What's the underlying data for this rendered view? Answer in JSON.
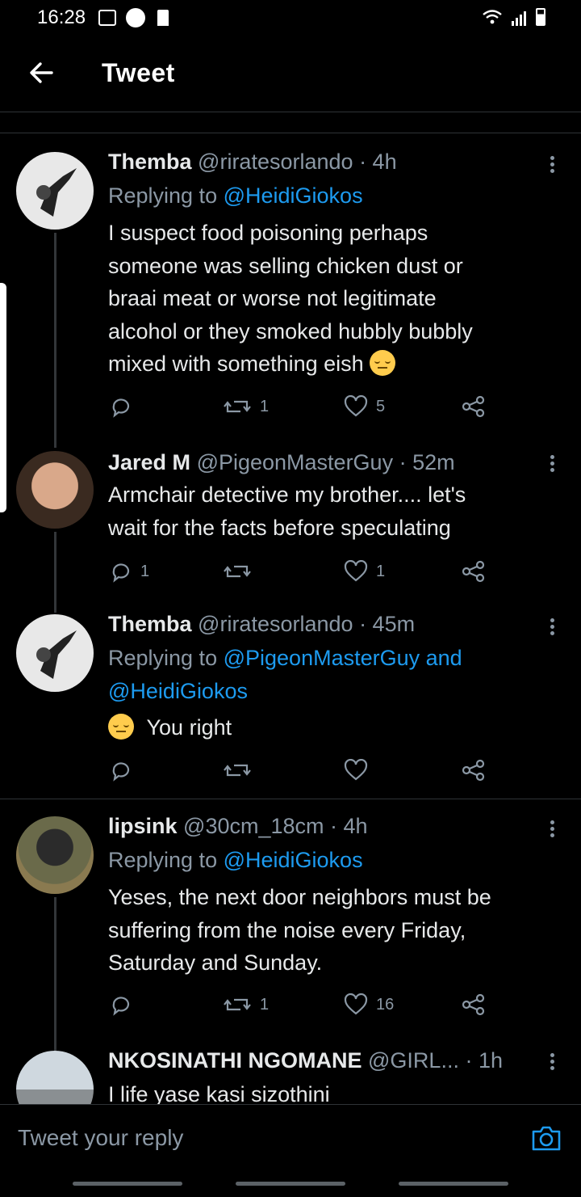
{
  "status_bar": {
    "time": "16:28"
  },
  "header": {
    "title": "Tweet"
  },
  "tweets": [
    {
      "name": "Themba",
      "handle": "@riratesorlando",
      "time": "· 4h",
      "replying_prefix": "Replying to",
      "replying_to": "@HeidiGiokos",
      "text_lines": [
        "I suspect food poisoning perhaps",
        "someone was selling chicken dust or",
        "braai meat or worse not legitimate",
        "alcohol or they smoked hubbly bubbly",
        "mixed with something eish"
      ],
      "retweets": "1",
      "likes": "5"
    },
    {
      "name": "Jared M",
      "handle": "@PigeonMasterGuy",
      "time": "· 52m",
      "text_lines": [
        "Armchair detective my brother.... let's",
        "wait for the facts before speculating"
      ],
      "replies": "1",
      "likes": "1"
    },
    {
      "name": "Themba",
      "handle": "@riratesorlando",
      "time": "· 45m",
      "replying_prefix": "Replying to",
      "replying_to": "@PigeonMasterGuy",
      "replying_and": "and",
      "replying_to_2": "@HeidiGiokos",
      "text": "You right"
    },
    {
      "name": "lipsink",
      "handle": "@30cm_18cm",
      "time": "· 4h",
      "replying_prefix": "Replying to",
      "replying_to": "@HeidiGiokos",
      "text_lines": [
        "Yeses, the next door neighbors must be",
        "suffering from the noise every Friday,",
        "Saturday and Sunday."
      ],
      "retweets": "1",
      "likes": "16"
    },
    {
      "name": "NKOSINATHI NGOMANE",
      "handle": "@GIRL...",
      "time": "· 1h",
      "text": "I life yase kasi sizothini"
    }
  ],
  "reply_bar": {
    "placeholder": "Tweet your reply"
  },
  "colors": {
    "background": "#000000",
    "link": "#1d9bf0",
    "muted": "#8b98a5"
  },
  "icons": [
    "back-arrow-icon",
    "more-icon",
    "reply-icon",
    "retweet-icon",
    "like-icon",
    "share-icon",
    "camera-icon",
    "pensive-emoji"
  ]
}
